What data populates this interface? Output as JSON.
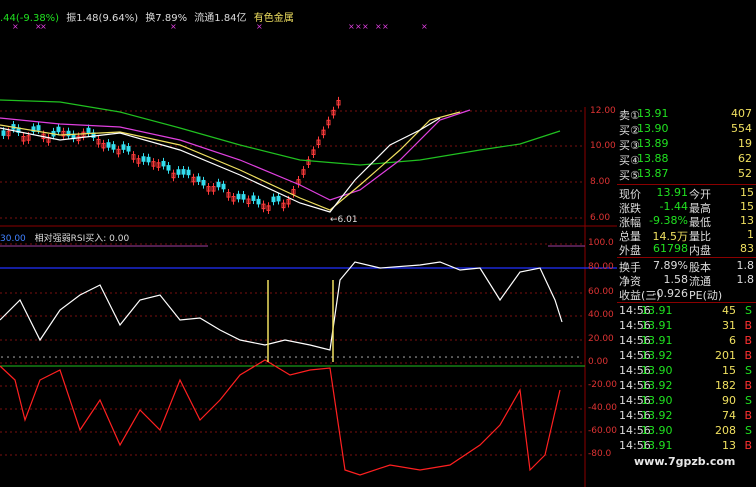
{
  "header": {
    "change_text": ".44(-9.38%)",
    "amplitude_text": "振1.48(9.64%)",
    "turnover_text": "换7.89%",
    "float_text": "流通1.84亿",
    "sector_text": "有色金属"
  },
  "price_chart": {
    "y_ticks": [
      "12.00",
      "10.00",
      "8.00",
      "6.00"
    ],
    "low_marker": "6.01",
    "colors": {
      "up": "#ff3b3b",
      "down": "#33ddee",
      "ma5": "#ffffff",
      "ma10": "#f0e060",
      "ma20": "#e040e0",
      "ma60": "#20c020"
    }
  },
  "indicator": {
    "label_value": "30.00",
    "label_text": "相对强弱RSI买入: 0.00",
    "y_ticks": [
      "100.0",
      "80.00",
      "60.00",
      "40.00",
      "20.00",
      "0.00",
      "-20.00",
      "-40.00",
      "-60.00",
      "-80.0"
    ]
  },
  "order_book": [
    {
      "label": "卖①",
      "price": "13.91",
      "vol": "407"
    },
    {
      "label": "买②",
      "price": "13.90",
      "vol": "554"
    },
    {
      "label": "买③",
      "price": "13.89",
      "vol": "19"
    },
    {
      "label": "买④",
      "price": "13.88",
      "vol": "62"
    },
    {
      "label": "买⑤",
      "price": "13.87",
      "vol": "52"
    }
  ],
  "quote_stats": [
    {
      "l1": "现价",
      "v1": "13.91",
      "l2": "今开",
      "v2": "15"
    },
    {
      "l1": "涨跌",
      "v1": "-1.44",
      "l2": "最高",
      "v2": "15"
    },
    {
      "l1": "涨幅",
      "v1": "-9.38%",
      "l2": "最低",
      "v2": "13"
    },
    {
      "l1": "总量",
      "v1": "14.5万",
      "l2": "量比",
      "v2": "1"
    },
    {
      "l1": "外盘",
      "v1": "61798",
      "l2": "内盘",
      "v2": "83"
    }
  ],
  "quote_stats2": [
    {
      "l1": "换手",
      "v1": "7.89%",
      "l2": "股本",
      "v2": "1.8"
    },
    {
      "l1": "净资",
      "v1": "1.58",
      "l2": "流通",
      "v2": "1.8"
    },
    {
      "l1": "收益(三)",
      "v1": "-0.926",
      "l2": "PE(动)",
      "v2": ""
    }
  ],
  "trades": [
    {
      "time": "14:56",
      "price": "13.91",
      "vol": "45",
      "side": "S"
    },
    {
      "time": "14:56",
      "price": "13.91",
      "vol": "31",
      "side": "B"
    },
    {
      "time": "14:56",
      "price": "13.91",
      "vol": "6",
      "side": "B"
    },
    {
      "time": "14:56",
      "price": "13.92",
      "vol": "201",
      "side": "B"
    },
    {
      "time": "14:56",
      "price": "13.90",
      "vol": "15",
      "side": "S"
    },
    {
      "time": "14:56",
      "price": "13.92",
      "vol": "182",
      "side": "B"
    },
    {
      "time": "14:56",
      "price": "13.90",
      "vol": "90",
      "side": "S"
    },
    {
      "time": "14:56",
      "price": "13.92",
      "vol": "74",
      "side": "B"
    },
    {
      "time": "14:56",
      "price": "13.90",
      "vol": "208",
      "side": "S"
    },
    {
      "time": "14:56",
      "price": "13.91",
      "vol": "13",
      "side": "B"
    }
  ],
  "watermark": "www.7gpzb.com"
}
